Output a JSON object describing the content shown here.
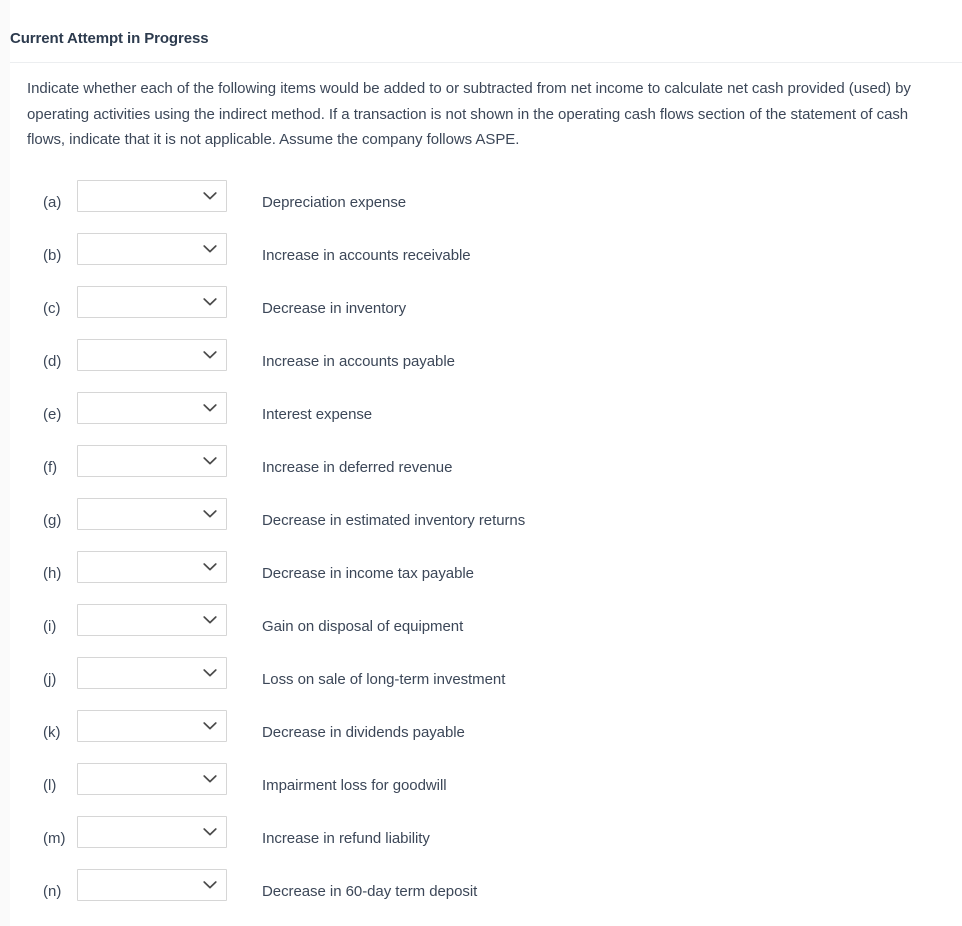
{
  "panel": {
    "heading": "Current Attempt in Progress",
    "instructions": "Indicate whether each of the following items would be added to or subtracted from net income to calculate net cash provided (used) by operating activities using the indirect method. If a transaction is not shown in the operating cash flows section of the statement of cash flows, indicate that it is not applicable. Assume the company follows ASPE."
  },
  "icons": {
    "chevron": "chevron-down-icon"
  },
  "colors": {
    "text": "#3c4758",
    "heading": "#2d3b4e",
    "border": "#d6d6d6",
    "divider": "#eceef0",
    "background": "#ffffff"
  },
  "select": {
    "selected_value": "",
    "placeholder": "",
    "options": []
  },
  "items": [
    {
      "letter": "(a)",
      "label": "Depreciation expense",
      "value": ""
    },
    {
      "letter": "(b)",
      "label": "Increase in accounts receivable",
      "value": ""
    },
    {
      "letter": "(c)",
      "label": "Decrease in inventory",
      "value": ""
    },
    {
      "letter": "(d)",
      "label": "Increase in accounts payable",
      "value": ""
    },
    {
      "letter": "(e)",
      "label": "Interest expense",
      "value": ""
    },
    {
      "letter": "(f)",
      "label": "Increase in deferred revenue",
      "value": ""
    },
    {
      "letter": "(g)",
      "label": "Decrease in estimated inventory returns",
      "value": ""
    },
    {
      "letter": "(h)",
      "label": "Decrease in income tax payable",
      "value": ""
    },
    {
      "letter": "(i)",
      "label": "Gain on disposal of equipment",
      "value": ""
    },
    {
      "letter": "(j)",
      "label": "Loss on sale of long-term investment",
      "value": ""
    },
    {
      "letter": "(k)",
      "label": "Decrease in dividends payable",
      "value": ""
    },
    {
      "letter": "(l)",
      "label": "Impairment loss for goodwill",
      "value": ""
    },
    {
      "letter": "(m)",
      "label": "Increase in refund liability",
      "value": ""
    },
    {
      "letter": "(n)",
      "label": "Decrease in 60-day term deposit",
      "value": ""
    }
  ]
}
